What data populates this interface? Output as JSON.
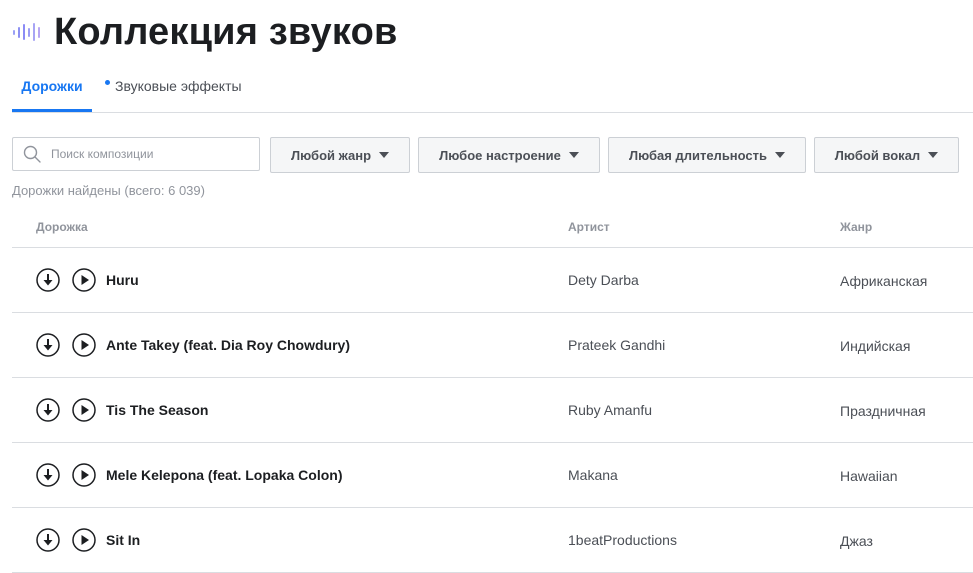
{
  "header": {
    "title": "Коллекция звуков",
    "logo_icon": "sound-wave-icon"
  },
  "tabs": [
    {
      "label": "Дорожки",
      "active": true
    },
    {
      "label": "Звуковые эффекты",
      "active": false
    }
  ],
  "search": {
    "placeholder": "Поиск композиции",
    "value": "",
    "icon": "search-icon"
  },
  "filters": [
    {
      "label": "Любой жанр"
    },
    {
      "label": "Любое настроение"
    },
    {
      "label": "Любая длительность"
    },
    {
      "label": "Любой вокал"
    }
  ],
  "results_text": "Дорожки найдены (всего: 6 039)",
  "table": {
    "columns": [
      "Дорожка",
      "Артист",
      "Жанр"
    ],
    "rows": [
      {
        "title": "Huru",
        "artist": "Dety Darba",
        "genre": "Африканская"
      },
      {
        "title": "Ante Takey (feat. Dia Roy Chowdury)",
        "artist": "Prateek Gandhi",
        "genre": "Индийская"
      },
      {
        "title": "Tis The Season",
        "artist": "Ruby Amanfu",
        "genre": "Праздничная"
      },
      {
        "title": "Mele Kelepona (feat. Lopaka Colon)",
        "artist": "Makana",
        "genre": "Hawaiian"
      },
      {
        "title": "Sit In",
        "artist": "1beatProductions",
        "genre": "Джаз"
      }
    ]
  },
  "colors": {
    "accent": "#1877f2",
    "logo_start": "#8b8bf5",
    "logo_end": "#b7a6f3"
  }
}
